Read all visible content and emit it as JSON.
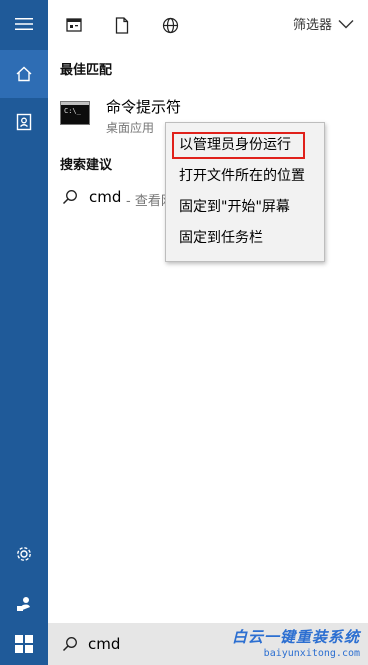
{
  "rail": {
    "items": [
      {
        "name": "hamburger-menu-icon"
      },
      {
        "name": "home-icon"
      },
      {
        "name": "notebook-icon"
      }
    ],
    "bottom_items": [
      {
        "name": "settings-gear-icon"
      },
      {
        "name": "feedback-person-icon"
      }
    ]
  },
  "toolbar": {
    "icons": [
      "apps-filter-icon",
      "documents-filter-icon",
      "web-filter-icon"
    ],
    "filter_label": "筛选器"
  },
  "best_match": {
    "title": "最佳匹配",
    "app_name": "命令提示符",
    "app_type": "桌面应用",
    "icon_text": "C:\\_"
  },
  "suggestions": {
    "title": "搜索建议",
    "items": [
      {
        "term": "cmd",
        "hint": "- 查看网"
      }
    ]
  },
  "context_menu": {
    "items": [
      {
        "label": "以管理员身份运行",
        "highlighted": true
      },
      {
        "label": "打开文件所在的位置",
        "highlighted": false
      },
      {
        "label": "固定到\"开始\"屏幕",
        "highlighted": false
      },
      {
        "label": "固定到任务栏",
        "highlighted": false
      }
    ]
  },
  "search_box": {
    "query": "cmd"
  },
  "watermark": {
    "text": "白云一键重装系统",
    "url": "baiyunxitong.com"
  },
  "colors": {
    "rail": "#1f5a99",
    "rail_active": "#2e6db4",
    "highlight_border": "#e0211b",
    "watermark": "#2c6fd1"
  }
}
